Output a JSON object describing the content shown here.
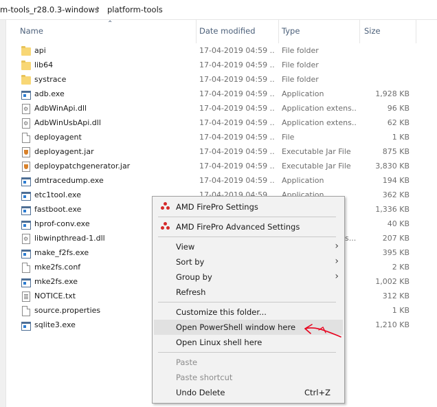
{
  "breadcrumb": {
    "parent": "m-tools_r28.0.3-windows",
    "current": "platform-tools"
  },
  "columns": {
    "name": "Name",
    "date": "Date modified",
    "type": "Type",
    "size": "Size"
  },
  "files": [
    {
      "name": "api",
      "date": "17-04-2019 04:59 ...",
      "type": "File folder",
      "size": "",
      "icon": "folder-icon"
    },
    {
      "name": "lib64",
      "date": "17-04-2019 04:59 ...",
      "type": "File folder",
      "size": "",
      "icon": "folder-icon"
    },
    {
      "name": "systrace",
      "date": "17-04-2019 04:59 ...",
      "type": "File folder",
      "size": "",
      "icon": "folder-icon"
    },
    {
      "name": "adb.exe",
      "date": "17-04-2019 04:59 ...",
      "type": "Application",
      "size": "1,928 KB",
      "icon": "application-icon"
    },
    {
      "name": "AdbWinApi.dll",
      "date": "17-04-2019 04:59 ...",
      "type": "Application extens...",
      "size": "96 KB",
      "icon": "dll-icon"
    },
    {
      "name": "AdbWinUsbApi.dll",
      "date": "17-04-2019 04:59 ...",
      "type": "Application extens...",
      "size": "62 KB",
      "icon": "dll-icon"
    },
    {
      "name": "deployagent",
      "date": "17-04-2019 04:59 ...",
      "type": "File",
      "size": "1 KB",
      "icon": "file-icon"
    },
    {
      "name": "deployagent.jar",
      "date": "17-04-2019 04:59 ...",
      "type": "Executable Jar File",
      "size": "875 KB",
      "icon": "jar-icon"
    },
    {
      "name": "deploypatchgenerator.jar",
      "date": "17-04-2019 04:59 ...",
      "type": "Executable Jar File",
      "size": "3,830 KB",
      "icon": "jar-icon"
    },
    {
      "name": "dmtracedump.exe",
      "date": "17-04-2019 04:59 ...",
      "type": "Application",
      "size": "194 KB",
      "icon": "application-icon"
    },
    {
      "name": "etc1tool.exe",
      "date": "17-04-2019 04:59 ...",
      "type": "Application",
      "size": "362 KB",
      "icon": "application-icon"
    },
    {
      "name": "fastboot.exe",
      "date": "",
      "type": "",
      "size": "1,336 KB",
      "icon": "application-icon"
    },
    {
      "name": "hprof-conv.exe",
      "date": "",
      "type": "",
      "size": "40 KB",
      "icon": "application-icon"
    },
    {
      "name": "libwinpthread-1.dll",
      "date": "",
      "type": "s...",
      "size": "207 KB",
      "icon": "dll-icon"
    },
    {
      "name": "make_f2fs.exe",
      "date": "",
      "type": "",
      "size": "395 KB",
      "icon": "application-icon"
    },
    {
      "name": "mke2fs.conf",
      "date": "",
      "type": "",
      "size": "2 KB",
      "icon": "file-icon"
    },
    {
      "name": "mke2fs.exe",
      "date": "",
      "type": "",
      "size": "1,002 KB",
      "icon": "application-icon"
    },
    {
      "name": "NOTICE.txt",
      "date": "",
      "type": "",
      "size": "312 KB",
      "icon": "text-file-icon"
    },
    {
      "name": "source.properties",
      "date": "",
      "type": "",
      "size": "1 KB",
      "icon": "file-icon"
    },
    {
      "name": "sqlite3.exe",
      "date": "",
      "type": "",
      "size": "1,210 KB",
      "icon": "application-icon"
    }
  ],
  "context_menu": {
    "amd_settings": "AMD FirePro Settings",
    "amd_advanced": "AMD FirePro Advanced Settings",
    "view": "View",
    "sort_by": "Sort by",
    "group_by": "Group by",
    "refresh": "Refresh",
    "customize": "Customize this folder...",
    "powershell": "Open PowerShell window here",
    "linux_shell": "Open Linux shell here",
    "paste": "Paste",
    "paste_shortcut": "Paste shortcut",
    "undo_delete": "Undo Delete",
    "undo_shortcut": "Ctrl+Z"
  },
  "colors": {
    "amd_red": "#d42a2a",
    "annotation_red": "#e8001c",
    "header_text": "#4c607a",
    "menu_bg": "#f2f2f2"
  }
}
